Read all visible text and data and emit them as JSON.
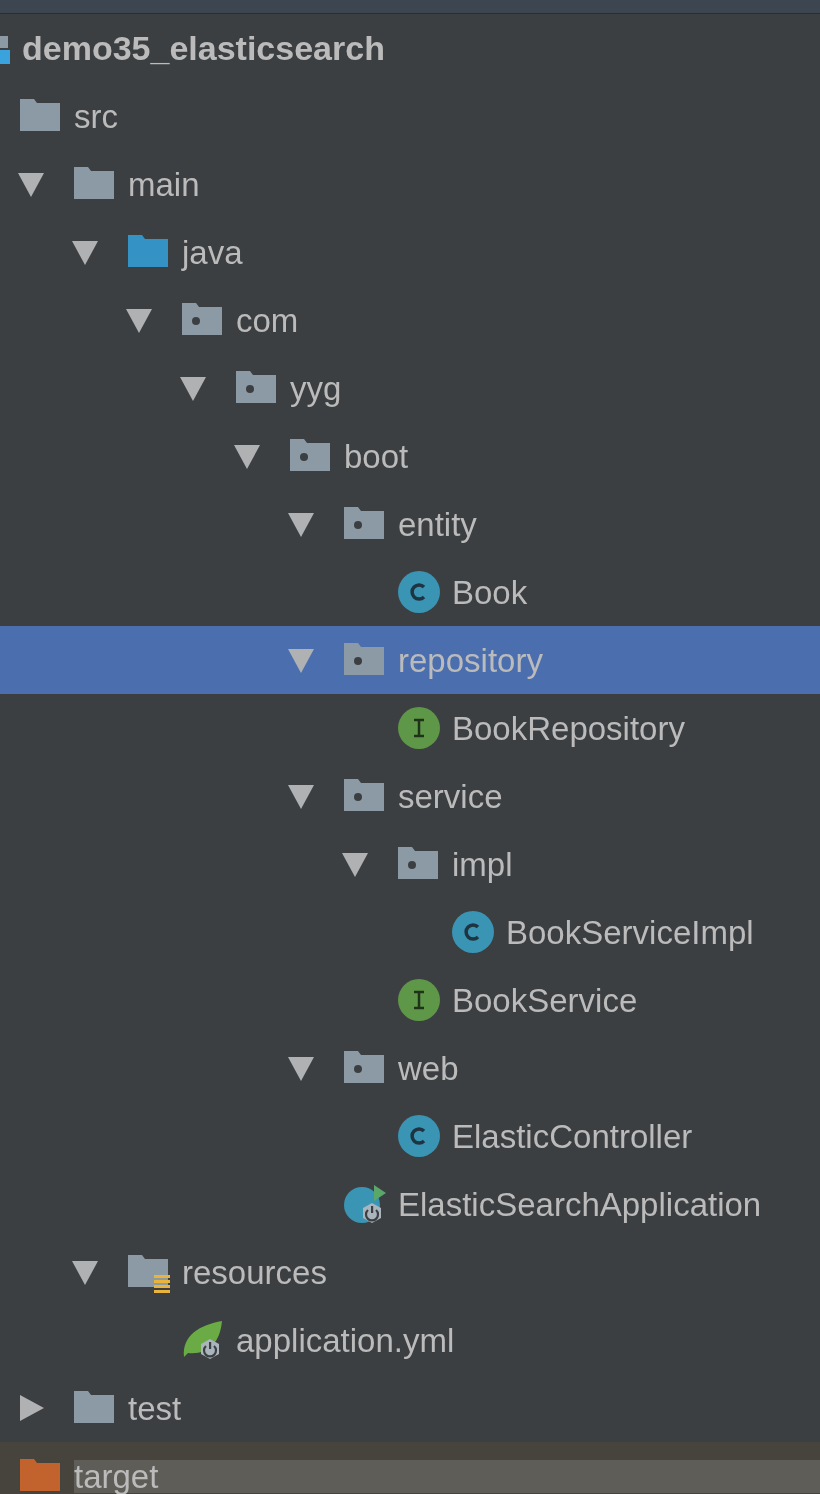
{
  "project": {
    "name": "demo35_elasticsearch"
  },
  "tree": [
    {
      "name": "src",
      "kind": "folder",
      "selected": false,
      "children": [
        {
          "name": "main",
          "kind": "folder",
          "expanded": true,
          "selected": false,
          "children": [
            {
              "name": "java",
              "kind": "source_root",
              "expanded": true,
              "selected": false,
              "children": [
                {
                  "name": "com",
                  "kind": "package",
                  "expanded": true,
                  "selected": false,
                  "children": [
                    {
                      "name": "yyg",
                      "kind": "package",
                      "expanded": true,
                      "selected": false,
                      "children": [
                        {
                          "name": "boot",
                          "kind": "package",
                          "expanded": true,
                          "selected": false,
                          "children": [
                            {
                              "name": "entity",
                              "kind": "package",
                              "expanded": true,
                              "selected": false,
                              "children": [
                                {
                                  "name": "Book",
                                  "kind": "class",
                                  "selected": false
                                }
                              ]
                            },
                            {
                              "name": "repository",
                              "kind": "package",
                              "expanded": true,
                              "selected": true,
                              "children": [
                                {
                                  "name": "BookRepository",
                                  "kind": "interface",
                                  "selected": false
                                }
                              ]
                            },
                            {
                              "name": "service",
                              "kind": "package",
                              "expanded": true,
                              "selected": false,
                              "children": [
                                {
                                  "name": "impl",
                                  "kind": "package",
                                  "expanded": true,
                                  "selected": false,
                                  "children": [
                                    {
                                      "name": "BookServiceImpl",
                                      "kind": "class",
                                      "selected": false
                                    }
                                  ]
                                },
                                {
                                  "name": "BookService",
                                  "kind": "interface",
                                  "selected": false
                                }
                              ]
                            },
                            {
                              "name": "web",
                              "kind": "package",
                              "expanded": true,
                              "selected": false,
                              "children": [
                                {
                                  "name": "ElasticController",
                                  "kind": "class",
                                  "selected": false
                                }
                              ]
                            },
                            {
                              "name": "ElasticSearchApplication",
                              "kind": "spring_app",
                              "selected": false
                            }
                          ]
                        }
                      ]
                    }
                  ]
                }
              ]
            },
            {
              "name": "resources",
              "kind": "resource_root",
              "expanded": true,
              "selected": false,
              "children": [
                {
                  "name": "application.yml",
                  "kind": "spring_config",
                  "selected": false
                }
              ]
            }
          ]
        },
        {
          "name": "test",
          "kind": "folder",
          "expanded": false,
          "selected": false
        }
      ]
    },
    {
      "name": "target",
      "kind": "excluded_folder",
      "selected": false
    }
  ]
}
